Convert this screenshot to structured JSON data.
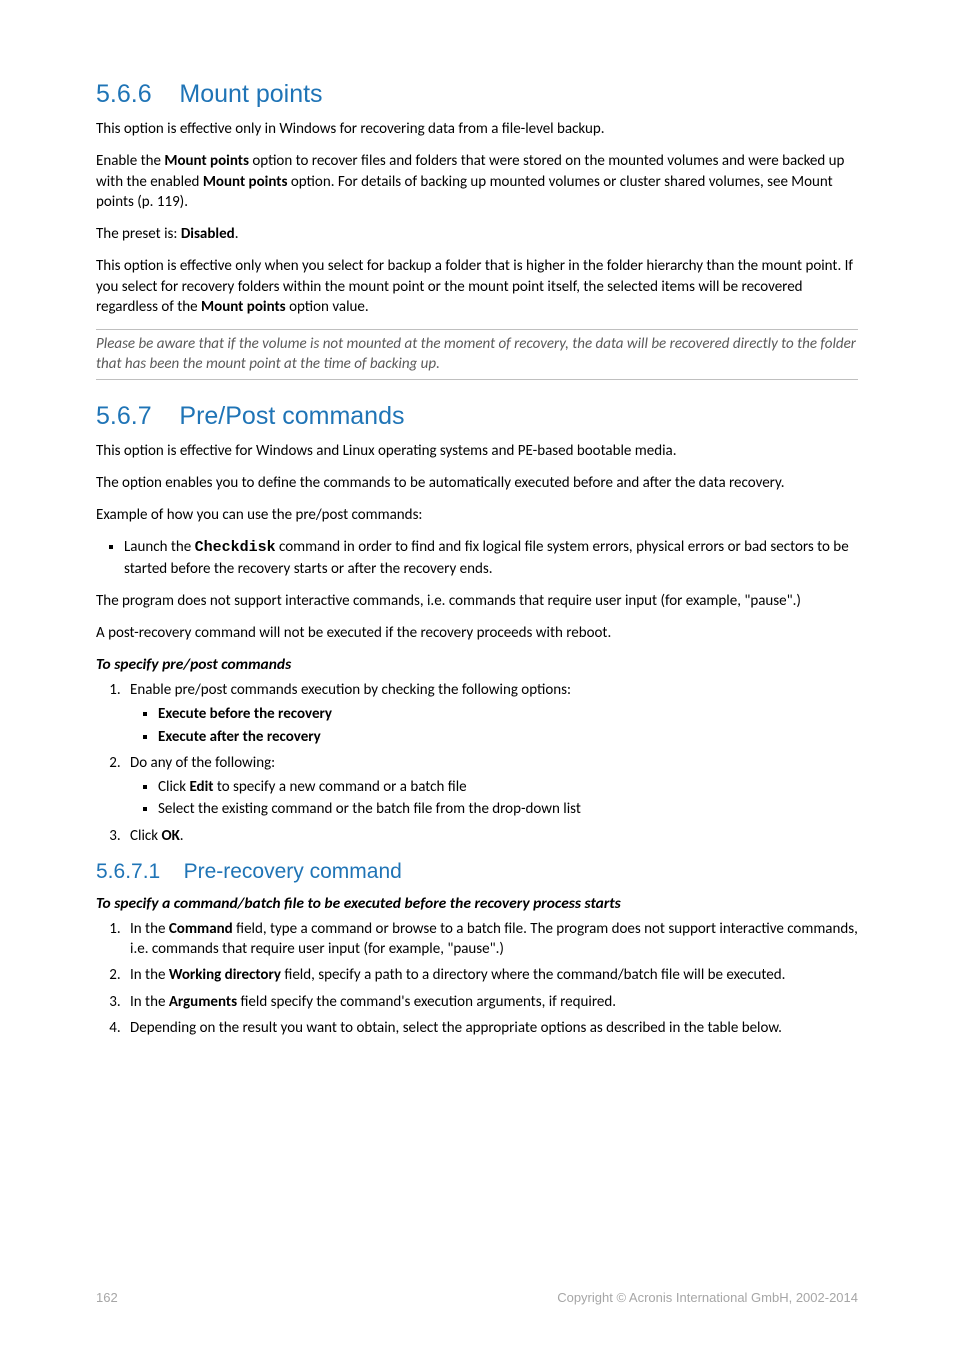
{
  "sec566": {
    "num": "5.6.6",
    "title": "Mount points",
    "p1a": "This option is effective only in Windows for recovering data from a file-level backup.",
    "p2a": "Enable the ",
    "p2b": "Mount points",
    "p2c": " option to recover files and folders that were stored on the mounted volumes and were backed up with the enabled ",
    "p2d": "Mount points",
    "p2e": " option. For details of backing up mounted volumes or cluster shared volumes, see Mount points (p. 119).",
    "p3a": "The preset is: ",
    "p3b": "Disabled",
    "p3c": ".",
    "p4a": "This option is effective only when you select for backup a folder that is higher in the folder hierarchy than the mount point. If you select for recovery folders within the mount point or the mount point itself, the selected items will be recovered regardless of the ",
    "p4b": "Mount points",
    "p4c": " option value.",
    "note": "Please be aware that if the volume is not mounted at the moment of recovery, the data will be recovered directly to the folder that has been the mount point at the time of backing up."
  },
  "sec567": {
    "num": "5.6.7",
    "title": "Pre/Post commands",
    "p1": "This option is effective for Windows and Linux operating systems and PE-based bootable media.",
    "p2": "The option enables you to define the commands to be automatically executed before and after the data recovery.",
    "p3": "Example of how you can use the pre/post commands:",
    "b1a": "Launch the ",
    "b1b": "Checkdisk",
    "b1c": " command in order to find and fix logical file system errors, physical errors or bad sectors to be started before the recovery starts or after the recovery ends.",
    "p4": "The program does not support interactive commands, i.e. commands that require user input (for example, \"pause\".)",
    "p5": "A post-recovery command will not be executed if the recovery proceeds with reboot.",
    "sub": "To specify pre/post commands",
    "n1": "Enable pre/post commands execution by checking the following options:",
    "n1a": "Execute before the recovery",
    "n1b": "Execute after the recovery",
    "n2": "Do any of the following:",
    "n2a_a": "Click ",
    "n2a_b": "Edit",
    "n2a_c": " to specify a new command or a batch file",
    "n2b": "Select the existing command or the batch file from the drop-down list",
    "n3a": "Click ",
    "n3b": "OK",
    "n3c": "."
  },
  "sec5671": {
    "num": "5.6.7.1",
    "title": "Pre-recovery command",
    "sub": "To specify a command/batch file to be executed before the recovery process starts",
    "n1a": "In the ",
    "n1b": "Command",
    "n1c": " field, type a command or browse to a batch file. The program does not support interactive commands, i.e. commands that require user input (for example, \"pause\".)",
    "n2a": "In the ",
    "n2b": "Working directory",
    "n2c": " field, specify a path to a directory where the command/batch file will be executed.",
    "n3a": "In the ",
    "n3b": "Arguments",
    "n3c": " field specify the command's execution arguments, if required.",
    "n4": "Depending on the result you want to obtain, select the appropriate options as described in the table below."
  },
  "footer": {
    "page": "162",
    "copy": "Copyright © Acronis International GmbH, 2002-2014"
  }
}
